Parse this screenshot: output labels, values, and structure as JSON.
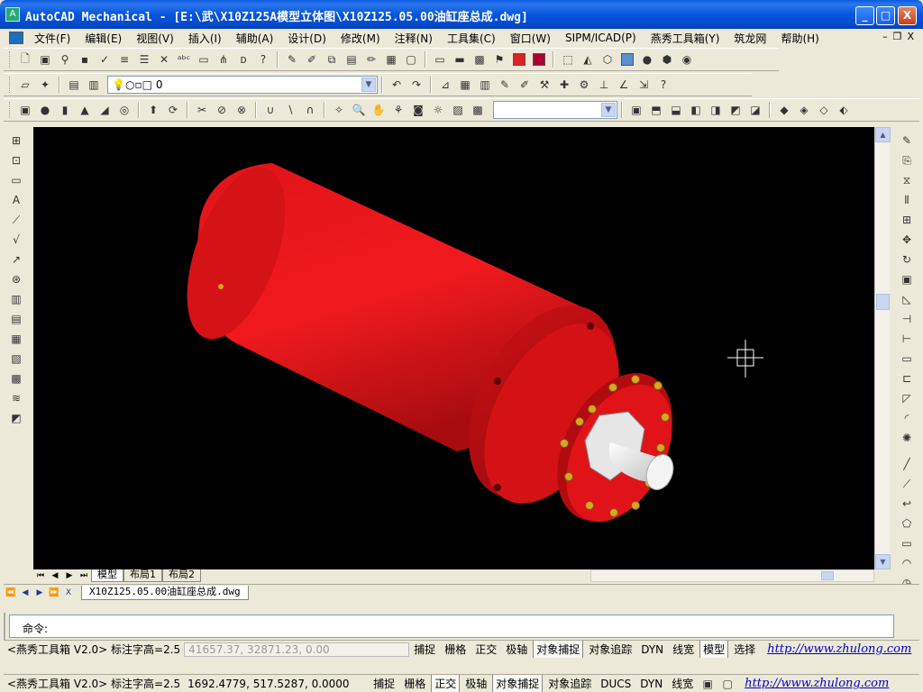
{
  "window": {
    "title": "AutoCAD Mechanical - [E:\\武\\X10Z125A模型立体图\\X10Z125.05.00油缸座总成.dwg]",
    "minimize": "_",
    "maximize": "□",
    "close": "X"
  },
  "menubar": {
    "items": [
      {
        "label": "文件(F)"
      },
      {
        "label": "编辑(E)"
      },
      {
        "label": "视图(V)"
      },
      {
        "label": "插入(I)"
      },
      {
        "label": "辅助(A)"
      },
      {
        "label": "设计(D)"
      },
      {
        "label": "修改(M)"
      },
      {
        "label": "注释(N)"
      },
      {
        "label": "工具集(C)"
      },
      {
        "label": "窗口(W)"
      },
      {
        "label": "SIPM/ICAD(P)"
      },
      {
        "label": "燕秀工具箱(Y)"
      },
      {
        "label": "筑龙网"
      },
      {
        "label": "帮助(H)"
      }
    ],
    "doc_min": "–",
    "doc_restore": "❐",
    "doc_close": "X"
  },
  "layer_toolbar": {
    "layer_value": "0"
  },
  "view_toolbar": {
    "combo_value": ""
  },
  "layout_tabs": {
    "items": [
      {
        "label": "模型",
        "active": true
      },
      {
        "label": "布局1",
        "active": false
      },
      {
        "label": "布局2",
        "active": false
      }
    ]
  },
  "document_tab": {
    "label": "X10Z125.05.00油缸座总成.dwg",
    "close": "X"
  },
  "command_line": {
    "prompt": "命令:"
  },
  "status_upper": {
    "prefix": "<燕秀工具箱 V2.0> 标注字高=2.5",
    "coordinates": "41657.37, 32871.23, 0.00",
    "toggles": [
      {
        "label": "捕捉",
        "on": false
      },
      {
        "label": "栅格",
        "on": false
      },
      {
        "label": "正交",
        "on": false
      },
      {
        "label": "极轴",
        "on": false
      },
      {
        "label": "对象捕捉",
        "on": true
      },
      {
        "label": "对象追踪",
        "on": false
      },
      {
        "label": "DYN",
        "on": false
      },
      {
        "label": "线宽",
        "on": false
      },
      {
        "label": "模型",
        "on": true
      }
    ],
    "select_label": "选择",
    "link": "http://www.zhulong.com"
  },
  "status_lower": {
    "prefix": "<燕秀工具箱 V2.0> 标注字高=2.5",
    "coordinates": "1692.4779, 517.5287, 0.0000",
    "toggles": [
      {
        "label": "捕捉",
        "on": false
      },
      {
        "label": "栅格",
        "on": false
      },
      {
        "label": "正交",
        "on": true
      },
      {
        "label": "极轴",
        "on": false
      },
      {
        "label": "对象捕捉",
        "on": true
      },
      {
        "label": "对象追踪",
        "on": false
      },
      {
        "label": "DUCS",
        "on": false
      },
      {
        "label": "DYN",
        "on": false
      },
      {
        "label": "线宽",
        "on": false
      }
    ],
    "link": "http://www.zhulong.com"
  },
  "colors": {
    "cylinder_red": "#e8141a",
    "cylinder_dark": "#8a0a0c",
    "bolt_gold": "#d9a520",
    "background": "#000000"
  }
}
